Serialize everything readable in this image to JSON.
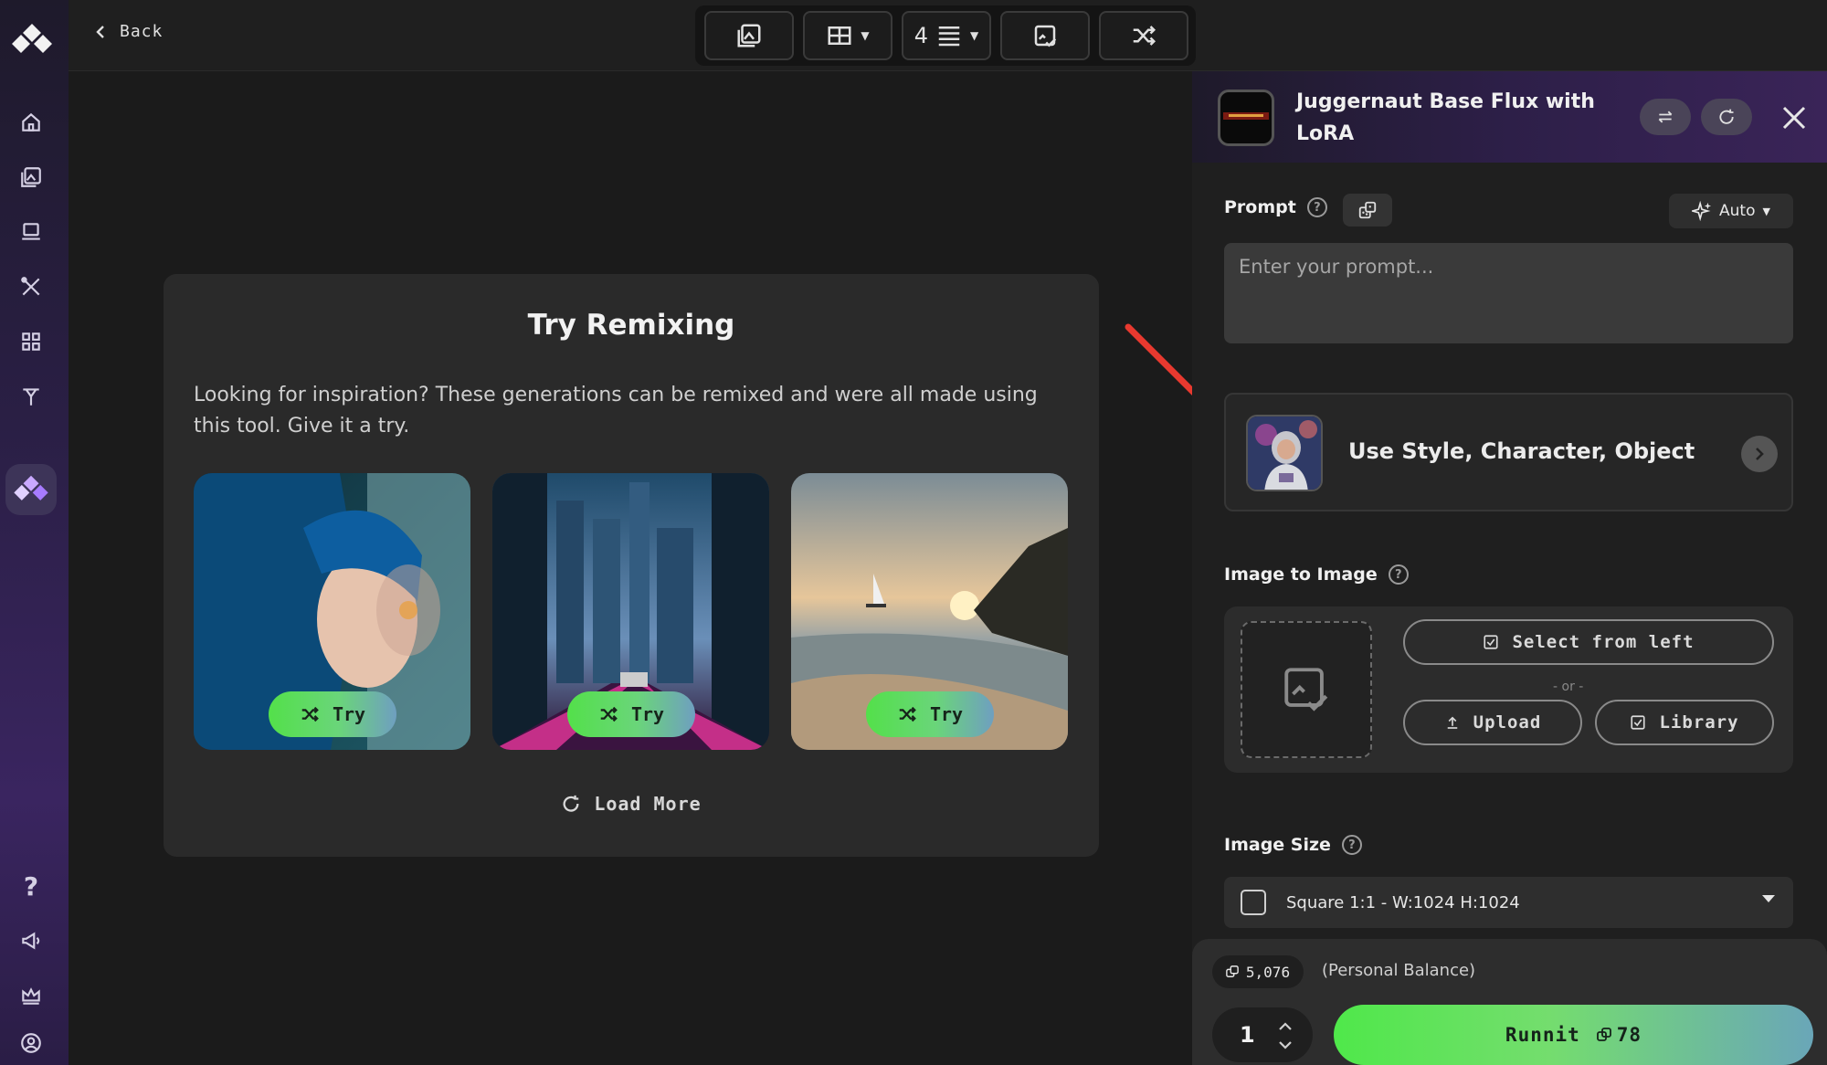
{
  "topbar": {
    "back_label": "Back",
    "grid_count": "4"
  },
  "main": {
    "card": {
      "title": "Try Remixing",
      "description": "Looking for inspiration? These generations can be remixed and were all made using this tool. Give it a try.",
      "thumbnails": [
        {
          "subject": "blue-haired woman at rainy window",
          "try_label": "Try"
        },
        {
          "subject": "neon city street",
          "try_label": "Try"
        },
        {
          "subject": "beach sunset with sailboat",
          "try_label": "Try"
        }
      ],
      "load_more_label": "Load More"
    }
  },
  "panel": {
    "model_name": "Juggernaut Base Flux with LoRA",
    "prompt_label": "Prompt",
    "auto_label": "Auto",
    "prompt_placeholder": "Enter your prompt...",
    "style_label": "Use Style, Character, Object",
    "i2i_label": "Image to Image",
    "select_from_left_label": "Select from left",
    "or_label": "- or -",
    "upload_label": "Upload",
    "library_label": "Library",
    "image_size_label": "Image Size",
    "image_size_value": "Square 1:1 - W:1024 H:1024",
    "balance_value": "5,076",
    "balance_label": "(Personal Balance)",
    "quantity": "1",
    "runnit_label": "Runnit",
    "runnit_cost": "78"
  },
  "colors": {
    "accent_green": "#53e04a",
    "accent_purple": "#3a2560",
    "annotation_arrow": "#e8392f"
  }
}
